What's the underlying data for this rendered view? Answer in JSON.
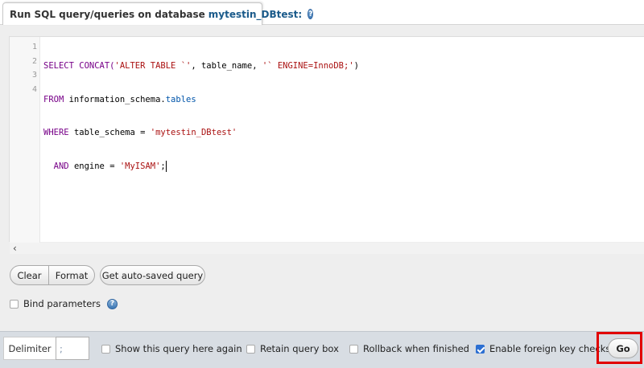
{
  "header": {
    "title_prefix": "Run SQL query/queries on database",
    "database": "mytestin_DBtest:",
    "help_icon": "?"
  },
  "editor": {
    "line_numbers": [
      "1",
      "2",
      "3",
      "4"
    ],
    "lines": [
      [
        "SELECT CONCAT(",
        "'ALTER TABLE `'",
        ", table_name, ",
        "'` ENGINE=InnoDB;'",
        ")"
      ],
      [
        "FROM ",
        "information_schema",
        ".",
        "tables"
      ],
      [
        "WHERE ",
        "table_schema",
        " = ",
        "'mytestin_DBtest'"
      ],
      [
        "  AND ",
        "engine",
        " = ",
        "'MyISAM'",
        ";"
      ]
    ],
    "scroll_left_glyph": "‹"
  },
  "buttons": {
    "clear": "Clear",
    "format": "Format",
    "auto_saved": "Get auto-saved query",
    "go": "Go"
  },
  "bind_parameters": {
    "label": "Bind parameters",
    "checked": false,
    "help_icon": "?"
  },
  "footer": {
    "delimiter_label": "Delimiter",
    "delimiter_value": ";",
    "options": [
      {
        "label": "Show this query here again",
        "checked": false
      },
      {
        "label": "Retain query box",
        "checked": false
      },
      {
        "label": "Rollback when finished",
        "checked": false
      },
      {
        "label": "Enable foreign key checks",
        "checked": true
      }
    ]
  },
  "colors": {
    "keyword": "#770088",
    "string": "#aa1111",
    "property": "#0055aa",
    "highlight_border": "#e10000",
    "checkbox_checked": "#2c6fd2"
  }
}
